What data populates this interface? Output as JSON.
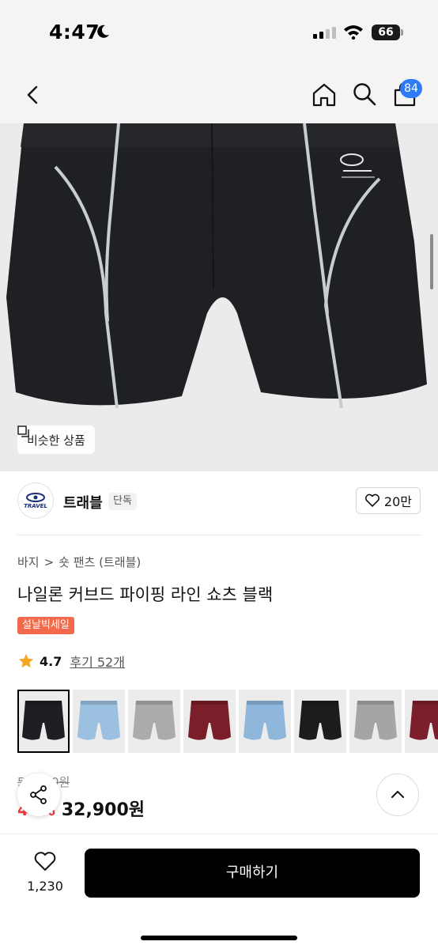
{
  "status": {
    "time": "4:47",
    "battery": "66"
  },
  "nav": {
    "cart_count": "84"
  },
  "hero": {
    "similar_label": "비슷한 상품"
  },
  "brand": {
    "logo_text": "TRAVEL",
    "name": "트래블",
    "tag": "단독",
    "likes": "20만"
  },
  "breadcrumb": {
    "category": "바지",
    "separator": ">",
    "subcategory": "숏 팬츠 (트래블)"
  },
  "product": {
    "title": "나일론 커브드 파이핑 라인 쇼츠 블랙",
    "sale_badge": "설날빅세일",
    "rating": "4.7",
    "review_label": "후기 52개",
    "original_price": "59,000원",
    "discount": "44%",
    "price": "32,900원"
  },
  "thumbnails": [
    {
      "color": "#1d1f22",
      "selected": true
    },
    {
      "color": "#9cc0e0",
      "selected": false
    },
    {
      "color": "#a9acaa",
      "selected": false
    },
    {
      "color": "#7a1e2a",
      "selected": false
    },
    {
      "color": "#8fb7dc",
      "selected": false
    },
    {
      "color": "#1c1c1e",
      "selected": false
    },
    {
      "color": "#a3a6a4",
      "selected": false
    },
    {
      "color": "#7b1f2c",
      "selected": false
    }
  ],
  "bottom": {
    "wish_count": "1,230",
    "buy_label": "구매하기"
  },
  "colors": {
    "accent_blue": "#2f7bf5",
    "sale_red": "#f26a4b",
    "discount_red": "#f23a3a"
  }
}
